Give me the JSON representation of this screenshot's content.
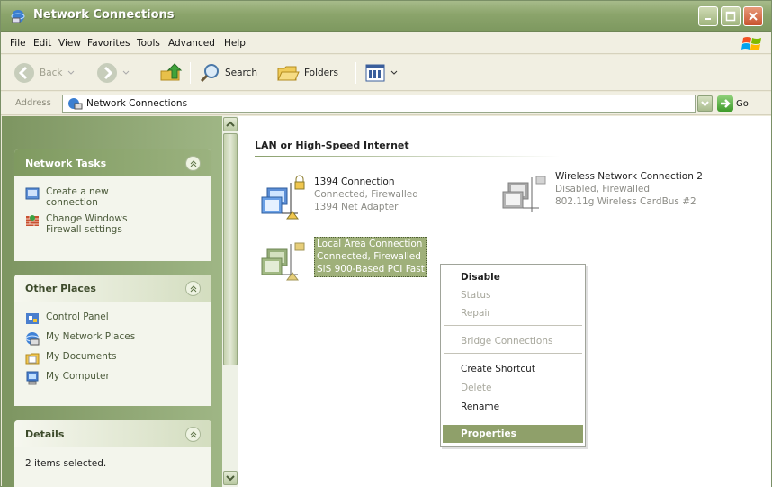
{
  "window": {
    "title": "Network Connections"
  },
  "menu": {
    "file": "File",
    "edit": "Edit",
    "view": "View",
    "favorites": "Favorites",
    "tools": "Tools",
    "advanced": "Advanced",
    "help": "Help"
  },
  "toolbar": {
    "back": "Back",
    "search": "Search",
    "folders": "Folders"
  },
  "address": {
    "label": "Address",
    "value": "Network Connections",
    "go": "Go"
  },
  "sidebar": {
    "network_tasks": {
      "title": "Network Tasks",
      "items": [
        {
          "label1": "Create a new",
          "label2": "connection"
        },
        {
          "label1": "Change Windows",
          "label2": "Firewall settings"
        }
      ]
    },
    "other_places": {
      "title": "Other Places",
      "items": [
        "Control Panel",
        "My Network Places",
        "My Documents",
        "My Computer"
      ]
    },
    "details": {
      "title": "Details",
      "text": "2 items selected."
    }
  },
  "content": {
    "group": "LAN or High-Speed Internet",
    "connections": [
      {
        "name": "1394 Connection",
        "status": "Connected, Firewalled",
        "device": "1394 Net Adapter"
      },
      {
        "name": "Wireless Network Connection 2",
        "status": "Disabled, Firewalled",
        "device": "802.11g Wireless CardBus #2"
      },
      {
        "name": "Local Area Connection",
        "status": "Connected, Firewalled",
        "device": "SiS 900-Based PCI Fast"
      }
    ]
  },
  "context_menu": {
    "items": [
      "Disable",
      "Status",
      "Repair",
      "Bridge Connections",
      "Create Shortcut",
      "Delete",
      "Rename",
      "Properties"
    ]
  }
}
